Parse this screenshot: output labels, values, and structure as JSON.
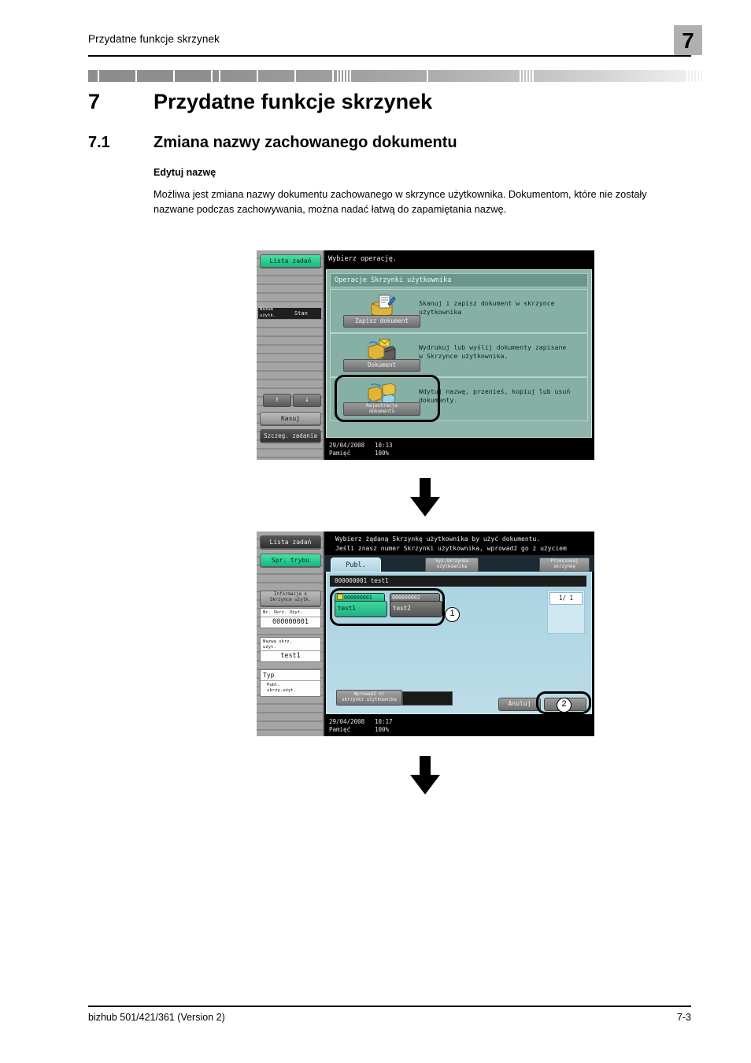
{
  "header": {
    "running_title": "Przydatne funkcje skrzynek",
    "chapter_badge": "7"
  },
  "chapter": {
    "number": "7",
    "title": "Przydatne funkcje skrzynek"
  },
  "section": {
    "number": "7.1",
    "title": "Zmiana nazwy zachowanego dokumentu",
    "subheading": "Edytuj nazwę",
    "paragraph": "Możliwa jest zmiana nazwy dokumentu zachowanego w skrzynce użytkownika. Dokumentom, które nie zostały nazwane podczas zachowywania, można nadać łatwą do zapamiętania nazwę."
  },
  "panel1": {
    "message": "Wybierz operację.",
    "rail": {
      "job_list_button": "Lista zadań",
      "column_user": "Nazwa\nużytk.",
      "column_status": "Stan",
      "up_arrow": "↑",
      "down_arrow": "↓",
      "delete_button": "Kasuj",
      "job_details_button": "Szczeg. zadania"
    },
    "body_title": "Operacje Skrzynki użytkownika",
    "rows": [
      {
        "button": "Zapisz dokument",
        "description": "Skanuj i zapisz dokument w skrzynce użytkownika",
        "icon": "save-document-icon"
      },
      {
        "button": "Dokument",
        "description": "Wydrukuj lub wyślij dokumenty zapisane\nw Skrzynce użytkownika.",
        "icon": "document-send-icon"
      },
      {
        "button": "Rejestracja\ndokumentu",
        "description": "Wdytuj nazwę, przenieś, kopiuj lub usuń dokumenty.",
        "icon": "document-manage-icon"
      }
    ],
    "status": {
      "date": "29/04/2008",
      "time": "10:13",
      "memory_label": "Pamięć",
      "memory_value": "100%"
    }
  },
  "panel2": {
    "message": "Wybierz żądaną Skrzynkę użytkownika by użyć dokumentu.\nJeśli znasz numer Skrzynki użytkownika, wprowadź go z użyciem klawiatury.",
    "rail": {
      "job_list_button": "Lista zadań",
      "check_mode_button": "Spr. trybu",
      "info_button": "Informacje o\nSkrzynce użytk.",
      "box_no_label": "Nr. Skrz. Użyt.",
      "box_no_value": "000000001",
      "box_name_label": "Nazwa skrz.\nużyt.",
      "box_name_value": "test1",
      "type_label": "Typ",
      "type_value": "Publ.\nskrzy.użyt."
    },
    "tabs": {
      "active": "Publ.",
      "system_box": "Sys.skrzynka\nużytkownika",
      "search_box": "Przeszukaj\nskrzynkę"
    },
    "breadcrumb": "000000001   test1",
    "boxes": [
      {
        "number": "000000001",
        "name": "test1",
        "locked": true,
        "selected": true
      },
      {
        "number": "000000002",
        "name": "test2",
        "locked": false,
        "selected": false
      }
    ],
    "pager": "1/  1",
    "entry_button": "Wprowadź nr\nskrzynki użytkownika",
    "entry_value": "",
    "cancel_button": "Anuluj",
    "ok_button": "OK",
    "status": {
      "date": "29/04/2008",
      "time": "10:17",
      "memory_label": "Pamięć",
      "memory_value": "100%"
    },
    "callouts": {
      "one": "1",
      "two": "2"
    }
  },
  "footer": {
    "left": "bizhub 501/421/361 (Version 2)",
    "right": "7-3"
  }
}
